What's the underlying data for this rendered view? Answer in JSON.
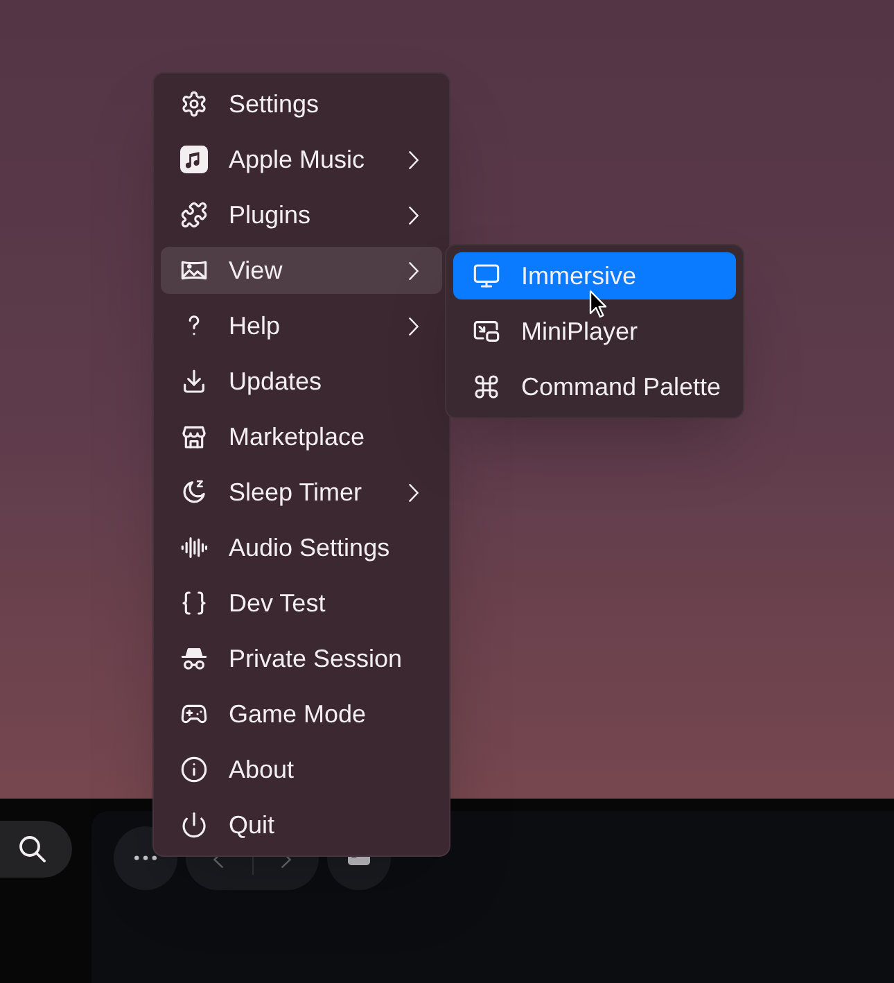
{
  "menu": {
    "items": [
      {
        "label": "Settings",
        "has_submenu": false,
        "selected": false
      },
      {
        "label": "Apple Music",
        "has_submenu": true,
        "selected": false
      },
      {
        "label": "Plugins",
        "has_submenu": true,
        "selected": false
      },
      {
        "label": "View",
        "has_submenu": true,
        "selected": true
      },
      {
        "label": "Help",
        "has_submenu": true,
        "selected": false
      },
      {
        "label": "Updates",
        "has_submenu": false,
        "selected": false
      },
      {
        "label": "Marketplace",
        "has_submenu": false,
        "selected": false
      },
      {
        "label": "Sleep Timer",
        "has_submenu": true,
        "selected": false
      },
      {
        "label": "Audio Settings",
        "has_submenu": false,
        "selected": false
      },
      {
        "label": "Dev Test",
        "has_submenu": false,
        "selected": false
      },
      {
        "label": "Private Session",
        "has_submenu": false,
        "selected": false
      },
      {
        "label": "Game Mode",
        "has_submenu": false,
        "selected": false
      },
      {
        "label": "About",
        "has_submenu": false,
        "selected": false
      },
      {
        "label": "Quit",
        "has_submenu": false,
        "selected": false
      }
    ]
  },
  "submenu": {
    "items": [
      {
        "label": "Immersive",
        "selected": true
      },
      {
        "label": "MiniPlayer",
        "selected": false
      },
      {
        "label": "Command Palette",
        "selected": false
      }
    ]
  }
}
